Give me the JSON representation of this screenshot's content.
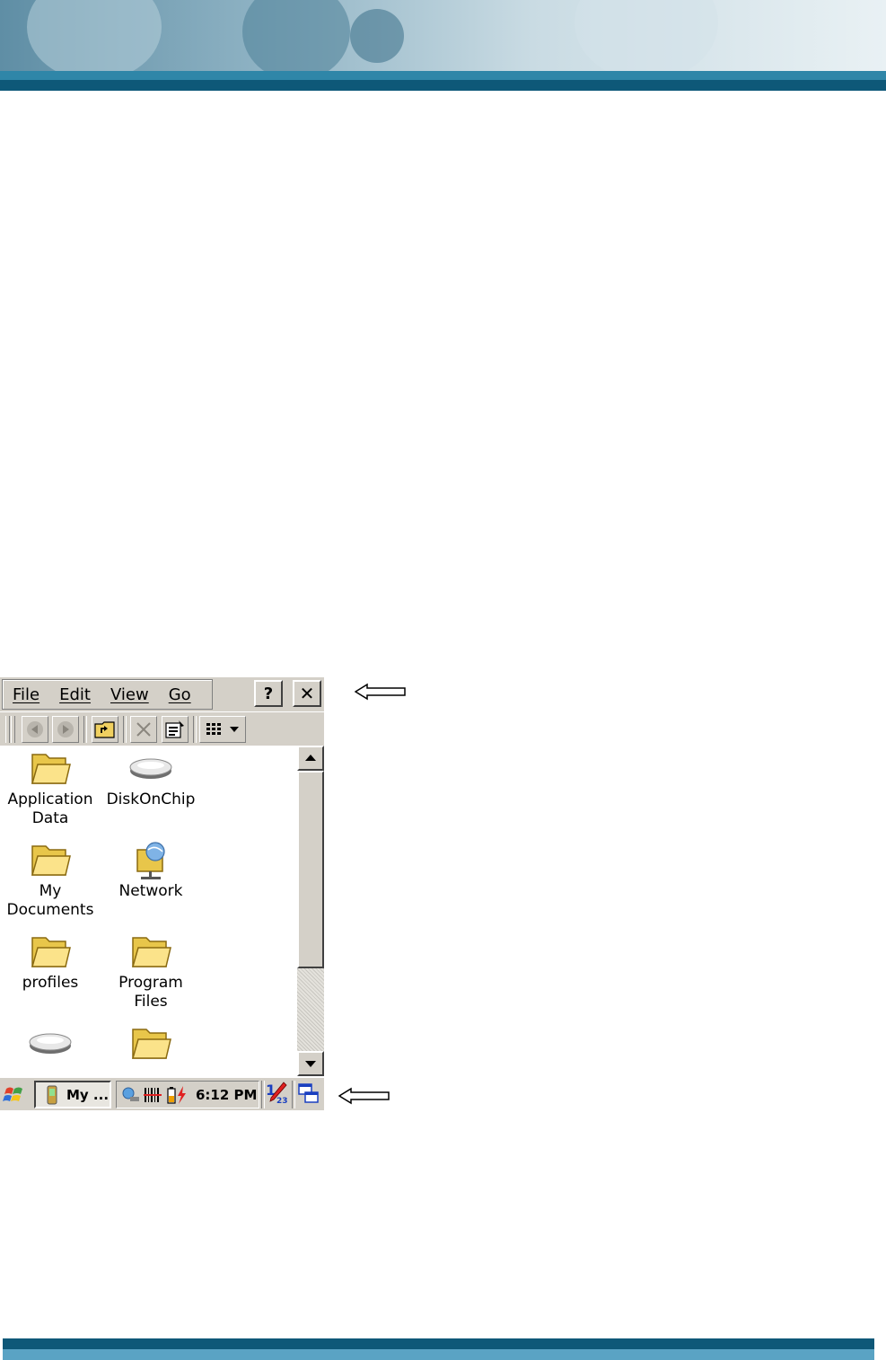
{
  "menubar": {
    "items": [
      {
        "label": "File"
      },
      {
        "label": "Edit"
      },
      {
        "label": "View"
      },
      {
        "label": "Go"
      }
    ],
    "help_label": "?",
    "close_label": "✕"
  },
  "toolbar": {
    "buttons": [
      "back-icon",
      "forward-icon",
      "up-folder-icon",
      "delete-icon",
      "properties-icon",
      "view-mode-icon"
    ]
  },
  "files": {
    "items": [
      {
        "label": "Application\nData",
        "icon": "folder-icon"
      },
      {
        "label": "DiskOnChip",
        "icon": "drive-icon"
      },
      {
        "label": "My\nDocuments",
        "icon": "folder-icon"
      },
      {
        "label": "Network",
        "icon": "network-folder-icon"
      },
      {
        "label": "profiles",
        "icon": "folder-icon"
      },
      {
        "label": "Program Files",
        "icon": "folder-icon"
      },
      {
        "label": "",
        "icon": "drive-icon"
      },
      {
        "label": "",
        "icon": "folder-icon"
      }
    ]
  },
  "taskbar": {
    "task_label": "My ...",
    "clock": "6:12 PM",
    "input_label": "1",
    "input_sub": "23"
  },
  "colors": {
    "window_face": "#d4d0c8",
    "banner_dark": "#0e5878",
    "banner_light": "#2f86a8"
  }
}
